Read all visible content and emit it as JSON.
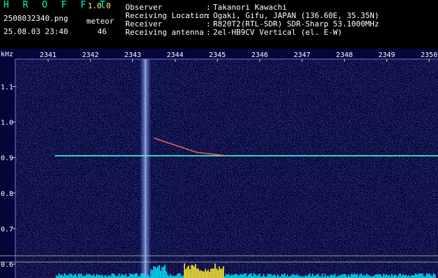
{
  "header": {
    "app_name": "H R O F F T",
    "version": "1.0.0",
    "file_name": "2508032340.png",
    "meteor_label": "meteor",
    "timestamp": "25.08.03 23:40",
    "meteor_count": "46",
    "info": [
      {
        "label": "Observer",
        "value": "Takanori Kawachi"
      },
      {
        "label": "Receiving Location",
        "value": "Ogaki, Gifu, JAPAN (136.60E, 35.35N)"
      },
      {
        "label": "Receiver",
        "value": "R820T2(RTL-SDR) SDR-Sharp 53.1000MHz"
      },
      {
        "label": "Receiving antenna",
        "value": "2el-HB9CV Vertical (el. E-W)"
      }
    ]
  },
  "chart_data": {
    "type": "heatmap",
    "y_unit_label": "kHz",
    "x_ticks": [
      "2341",
      "2342",
      "2343",
      "2344",
      "2345",
      "2346",
      "2347",
      "2348",
      "2349",
      "2350"
    ],
    "x_range": [
      2340.6,
      2350.2
    ],
    "y_ticks": [
      "1.1",
      "1.0",
      "0.9",
      "0.8",
      "0.7",
      "0.6"
    ],
    "y_range": [
      0.58,
      1.185
    ],
    "carrier_frequency_khz": 0.905,
    "carrier_start_time": 2341.0,
    "vertical_burst_time": 2343.3,
    "meteor_trace": [
      {
        "t": 2343.5,
        "f": 0.955
      },
      {
        "t": 2344.0,
        "f": 0.935
      },
      {
        "t": 2344.5,
        "f": 0.915
      },
      {
        "t": 2345.2,
        "f": 0.905
      }
    ],
    "colors": {
      "background": "#05053a",
      "noise": "#3a4cc8",
      "carrier": "#40ffd0",
      "meteor": "#ff6a5a",
      "burst": "#7aa0ff",
      "spectrum": "#00e5ff",
      "spectrum_peak": "#ffee33"
    }
  }
}
